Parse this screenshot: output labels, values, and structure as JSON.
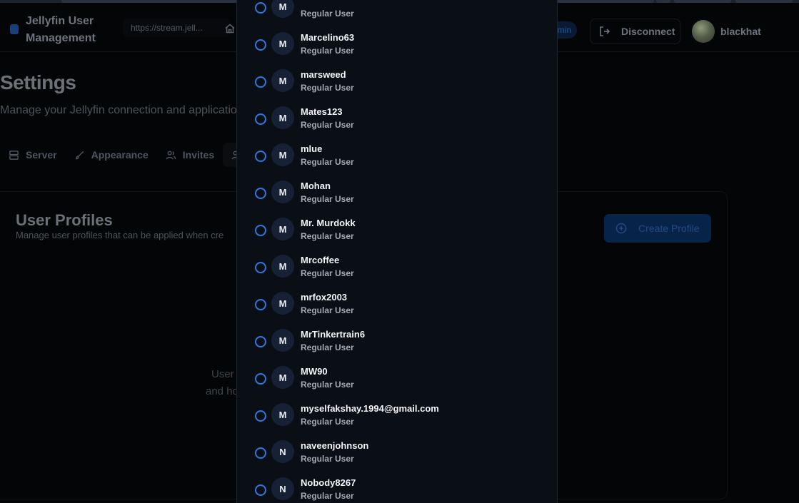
{
  "header": {
    "app_title": "Jellyfin User Management",
    "url": "https://stream.jell...",
    "admin_badge": "Admin",
    "disconnect_label": "Disconnect",
    "user_name": "blackhat"
  },
  "page": {
    "title": "Settings",
    "subtitle": "Manage your Jellyfin connection and application"
  },
  "tabs": [
    {
      "label": "Server",
      "icon": "server-icon"
    },
    {
      "label": "Appearance",
      "icon": "brush-icon"
    },
    {
      "label": "Invites",
      "icon": "users-icon"
    },
    {
      "label": "",
      "icon": "user-profile-icon"
    }
  ],
  "profiles_card": {
    "title": "User Profiles",
    "description": "Manage user profiles that can be applied when cre",
    "create_label": "Create Profile",
    "empty_line_1": "User",
    "empty_line_2": "and ho"
  },
  "user_list": {
    "items": [
      {
        "initial": "M",
        "name": "",
        "role": "Regular User"
      },
      {
        "initial": "M",
        "name": "Marcelino63",
        "role": "Regular User"
      },
      {
        "initial": "M",
        "name": "marsweed",
        "role": "Regular User"
      },
      {
        "initial": "M",
        "name": "Mates123",
        "role": "Regular User"
      },
      {
        "initial": "M",
        "name": "mlue",
        "role": "Regular User"
      },
      {
        "initial": "M",
        "name": "Mohan",
        "role": "Regular User"
      },
      {
        "initial": "M",
        "name": "Mr. Murdokk",
        "role": "Regular User"
      },
      {
        "initial": "M",
        "name": "Mrcoffee",
        "role": "Regular User"
      },
      {
        "initial": "M",
        "name": "mrfox2003",
        "role": "Regular User"
      },
      {
        "initial": "M",
        "name": "MrTinkertrain6",
        "role": "Regular User"
      },
      {
        "initial": "M",
        "name": "MW90",
        "role": "Regular User"
      },
      {
        "initial": "M",
        "name": "myselfakshay.1994@gmail.com",
        "role": "Regular User"
      },
      {
        "initial": "N",
        "name": "naveenjohnson",
        "role": "Regular User"
      },
      {
        "initial": "N",
        "name": "Nobody8267",
        "role": "Regular User"
      }
    ]
  },
  "colors": {
    "accent": "#2f78e0",
    "modal_bg": "#0a0e15",
    "page_bg": "#040507"
  }
}
